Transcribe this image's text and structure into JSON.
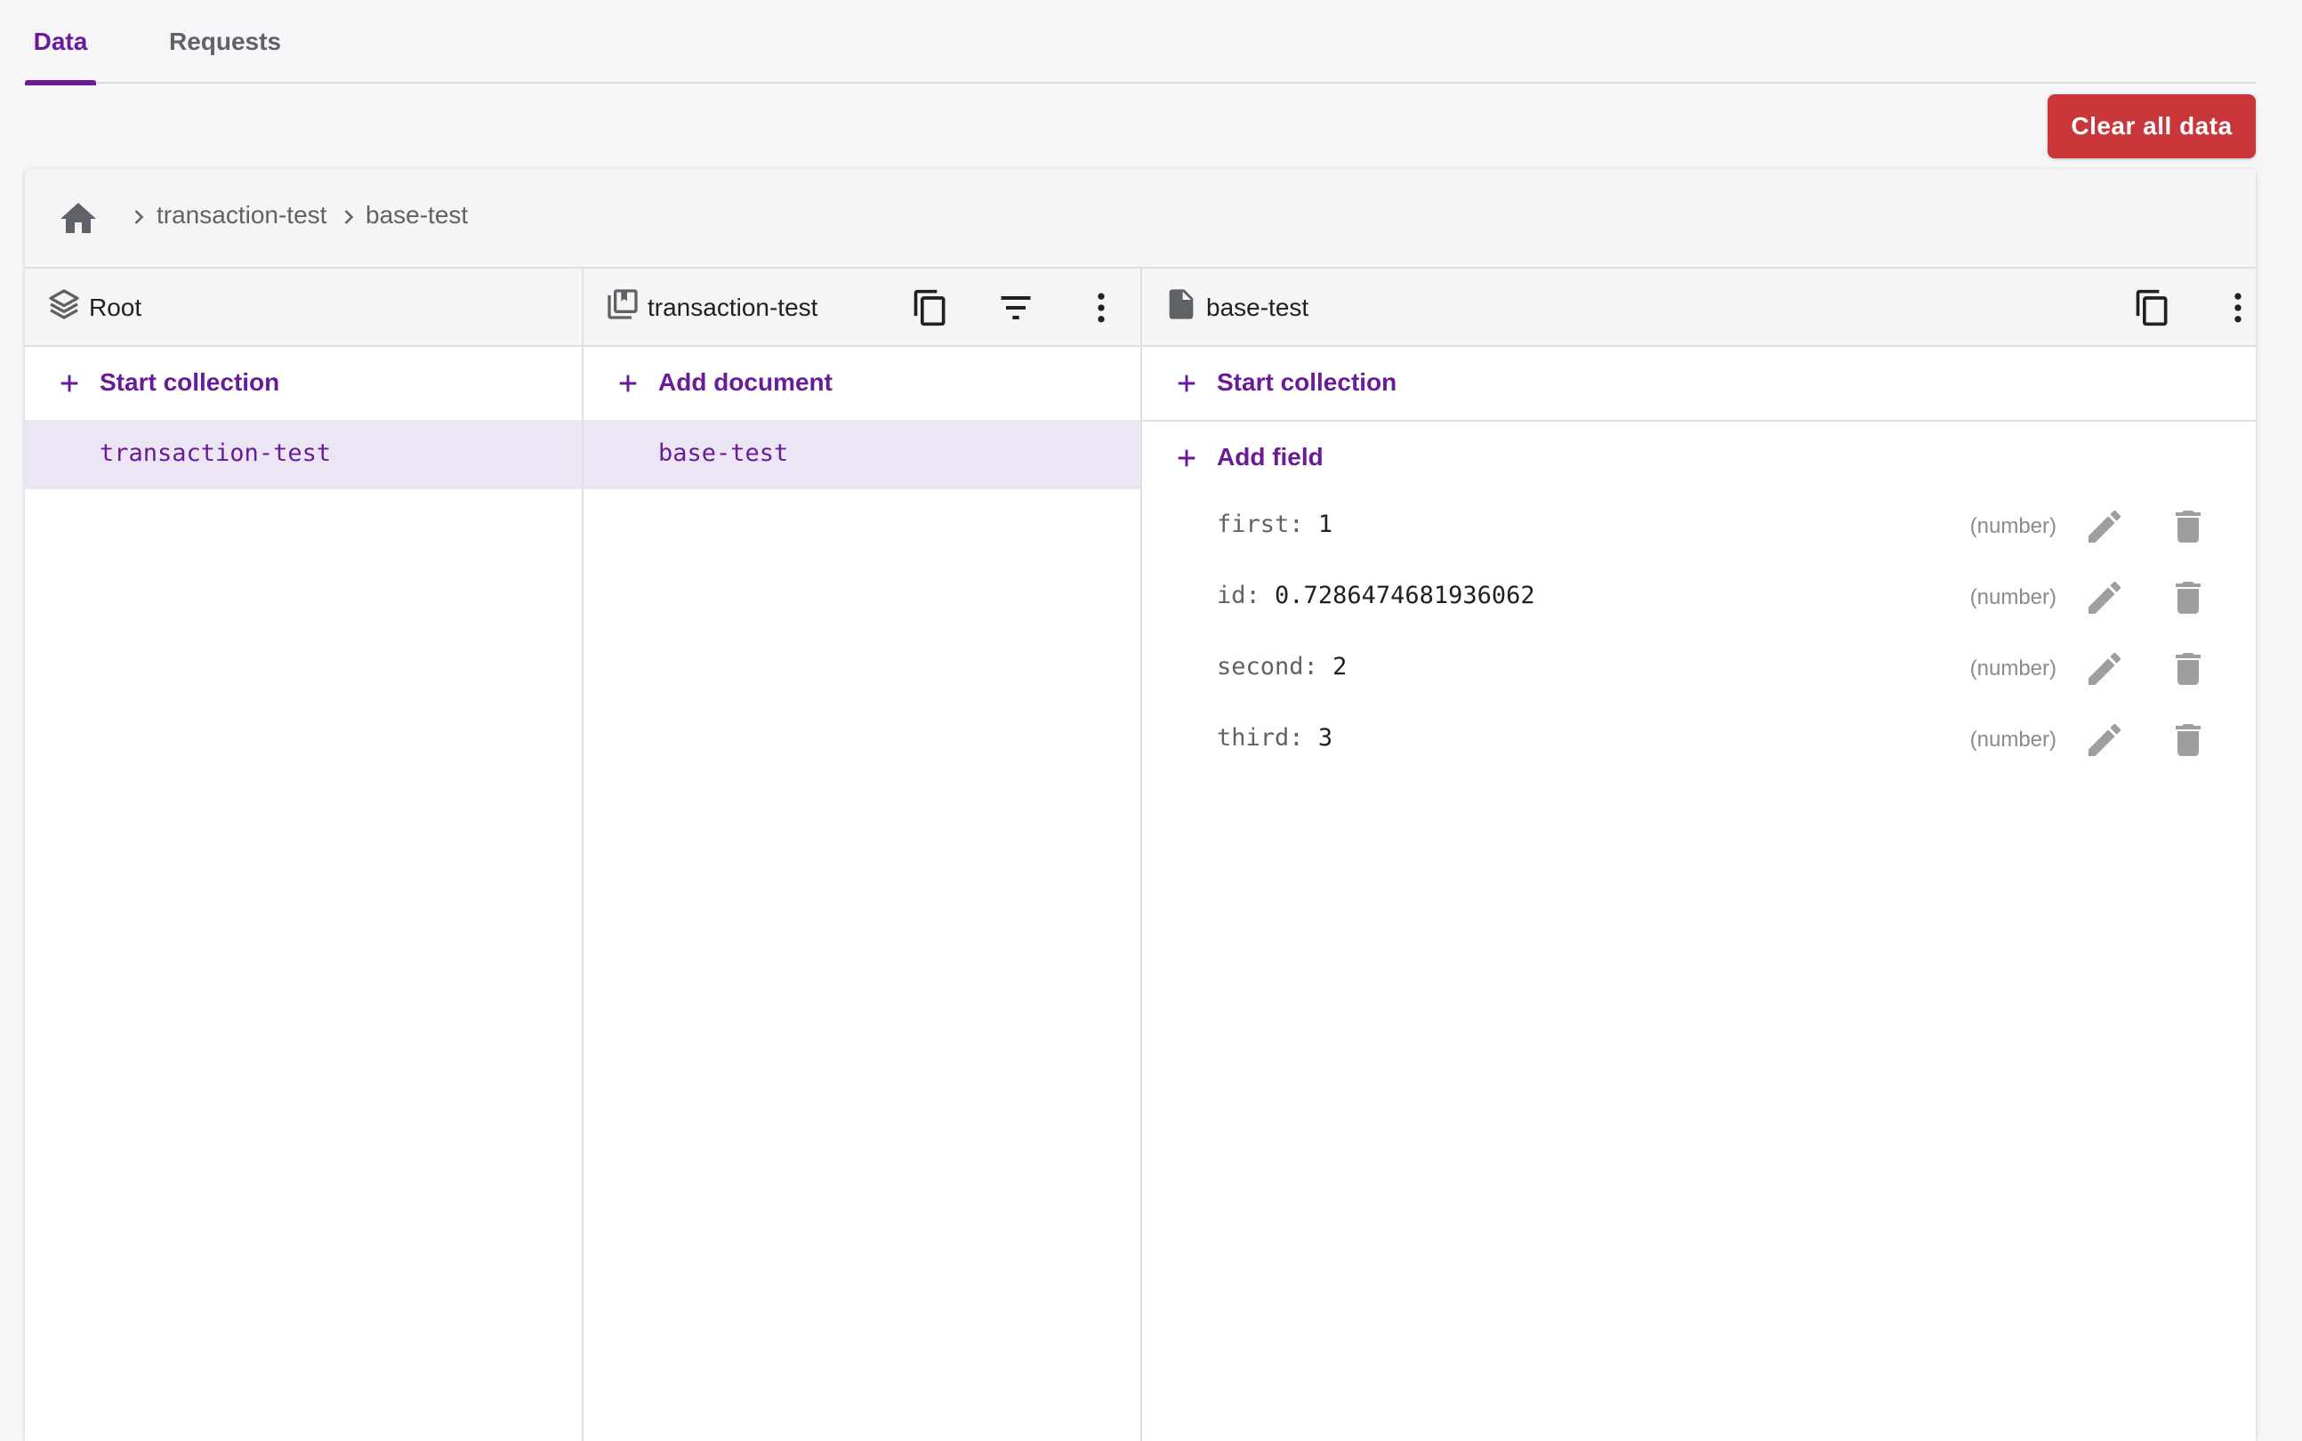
{
  "tabs": [
    {
      "label": "Data",
      "active": true
    },
    {
      "label": "Requests",
      "active": false
    }
  ],
  "clear_button": {
    "label": "Clear all data",
    "color": "#c9363a"
  },
  "accent_color": "#6a1b9a",
  "breadcrumb": {
    "home_icon": "home-icon",
    "items": [
      "transaction-test",
      "base-test"
    ]
  },
  "columns": {
    "root": {
      "title": "Root",
      "icon": "root-layers-icon",
      "action": "Start collection",
      "items": [
        "transaction-test"
      ]
    },
    "collection": {
      "title": "transaction-test",
      "icon": "collection-icon",
      "action": "Add document",
      "items": [
        "base-test"
      ]
    },
    "document": {
      "title": "base-test",
      "icon": "document-icon",
      "start_collection": "Start collection",
      "add_field": "Add field",
      "fields": [
        {
          "key": "first:",
          "value": "1",
          "type": "(number)"
        },
        {
          "key": "id:",
          "value": "0.7286474681936062",
          "type": "(number)"
        },
        {
          "key": "second:",
          "value": "2",
          "type": "(number)"
        },
        {
          "key": "third:",
          "value": "3",
          "type": "(number)"
        }
      ]
    }
  }
}
